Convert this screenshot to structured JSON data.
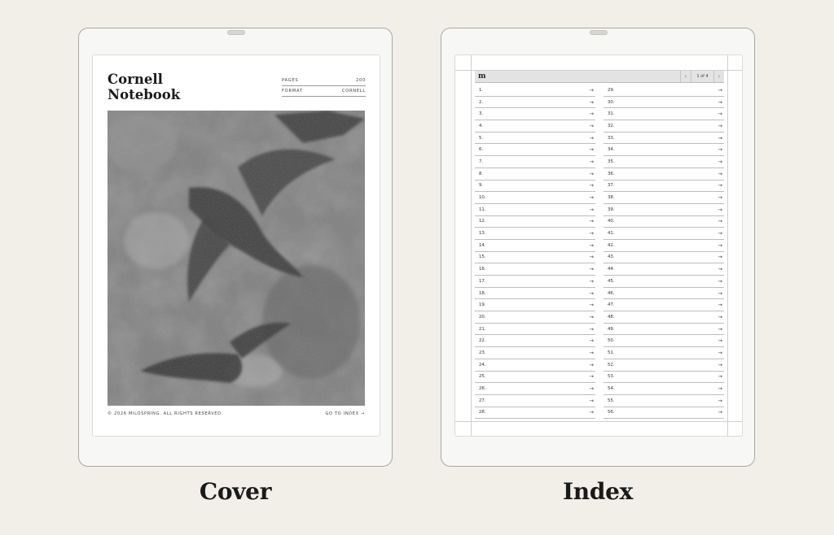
{
  "cover": {
    "caption": "Cover",
    "title_line1": "Cornell",
    "title_line2": "Notebook",
    "meta": [
      {
        "label": "PAGES",
        "value": "200"
      },
      {
        "label": "FORMAT",
        "value": "CORNELL"
      }
    ],
    "copyright": "© 2026 MILOSPRING. ALL RIGHTS RESERVED.",
    "go_to_index": "GO TO INDEX →",
    "artwork": "painting-of-birds-grayscale"
  },
  "index": {
    "caption": "Index",
    "logo": "m",
    "pager": {
      "prev": "‹",
      "label": "1 of 4",
      "next": "›"
    },
    "arrow": "→",
    "left_entries": [
      "1.",
      "2.",
      "3.",
      "4.",
      "5.",
      "6.",
      "7.",
      "8.",
      "9.",
      "10.",
      "11.",
      "12.",
      "13.",
      "14.",
      "15.",
      "16.",
      "17.",
      "18.",
      "19.",
      "20.",
      "21.",
      "22.",
      "23.",
      "24.",
      "25.",
      "26.",
      "27.",
      "28."
    ],
    "right_entries": [
      "29.",
      "30.",
      "31.",
      "32.",
      "33.",
      "34.",
      "35.",
      "36.",
      "37.",
      "38.",
      "39.",
      "40.",
      "41.",
      "42.",
      "43.",
      "44.",
      "45.",
      "46.",
      "47.",
      "48.",
      "49.",
      "50.",
      "51.",
      "52.",
      "53.",
      "54.",
      "55.",
      "56."
    ]
  },
  "colors": {
    "background": "#f2efe8",
    "device": "#f7f7f6",
    "device_border": "#a9a8a4",
    "screen": "#ffffff",
    "text": "#1e1e1e"
  }
}
